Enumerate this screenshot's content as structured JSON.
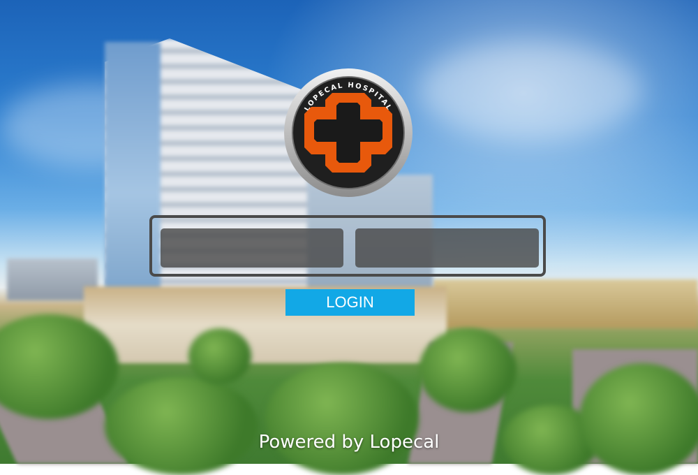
{
  "logo": {
    "text": "LOPECAL HOSPITAL",
    "icon": "medical-cross-icon",
    "cross_color": "#e8590c",
    "ring_color": "#c8c8c8",
    "inner_color": "#1f1f1f"
  },
  "form": {
    "username_value": "",
    "password_value": "",
    "login_label": "LOGIN"
  },
  "footer": {
    "text": "Powered by Lopecal"
  },
  "colors": {
    "login_button": "#12a8e6",
    "field": "#4a4a4a"
  }
}
